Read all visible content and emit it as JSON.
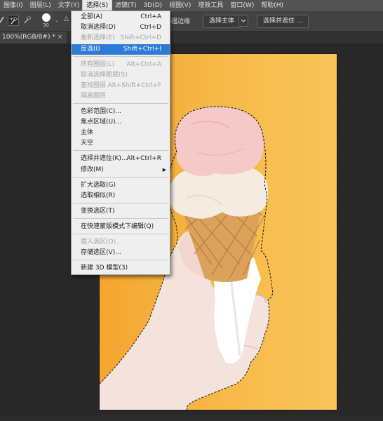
{
  "menubar": {
    "items": [
      "图像(I)",
      "图层(L)",
      "文字(Y)",
      "选择(S)",
      "滤镜(T)",
      "3D(D)",
      "视图(V)",
      "增效工具",
      "窗口(W)",
      "帮助(H)"
    ],
    "active_index": 3
  },
  "options": {
    "brush_size": "30",
    "edge_label": "强边缘",
    "select_subject": "选择主体",
    "select_mask": "选择并遮住 ..."
  },
  "tab": {
    "title": "100%(RGB/8#) *",
    "close": "×"
  },
  "select_menu": {
    "items": [
      {
        "label": "全部(A)",
        "shortcut": "Ctrl+A",
        "state": "normal"
      },
      {
        "label": "取消选择(D)",
        "shortcut": "Ctrl+D",
        "state": "normal"
      },
      {
        "label": "重新选择(E)",
        "shortcut": "Shift+Ctrl+D",
        "state": "disabled"
      },
      {
        "label": "反选(I)",
        "shortcut": "Shift+Ctrl+I",
        "state": "highlight"
      },
      {
        "label": "所有图层(L)",
        "shortcut": "Alt+Ctrl+A",
        "state": "disabled"
      },
      {
        "label": "取消选择图层(S)",
        "shortcut": "",
        "state": "disabled"
      },
      {
        "label": "查找图层",
        "shortcut": "Alt+Shift+Ctrl+F",
        "state": "disabled"
      },
      {
        "label": "隔离图层",
        "shortcut": "",
        "state": "disabled"
      },
      {
        "label": "色彩范围(C)...",
        "shortcut": "",
        "state": "normal"
      },
      {
        "label": "焦点区域(U)...",
        "shortcut": "",
        "state": "normal"
      },
      {
        "label": "主体",
        "shortcut": "",
        "state": "normal"
      },
      {
        "label": "天空",
        "shortcut": "",
        "state": "normal"
      },
      {
        "label": "选择并遮住(K)...",
        "shortcut": "Alt+Ctrl+R",
        "state": "normal"
      },
      {
        "label": "修改(M)",
        "shortcut": "",
        "state": "normal",
        "submenu": true
      },
      {
        "label": "扩大选取(G)",
        "shortcut": "",
        "state": "normal"
      },
      {
        "label": "选取相似(R)",
        "shortcut": "",
        "state": "normal"
      },
      {
        "label": "变换选区(T)",
        "shortcut": "",
        "state": "normal"
      },
      {
        "label": "在快速蒙版模式下编辑(Q)",
        "shortcut": "",
        "state": "normal"
      },
      {
        "label": "载入选区(O)...",
        "shortcut": "",
        "state": "disabled"
      },
      {
        "label": "存储选区(V)...",
        "shortcut": "",
        "state": "normal"
      },
      {
        "label": "新建 3D 模型(3)",
        "shortcut": "",
        "state": "normal"
      }
    ]
  },
  "colors": {
    "menubar_bg": "#535353",
    "highlight": "#2c7cd6",
    "canvas_background": "#f7b53f"
  }
}
